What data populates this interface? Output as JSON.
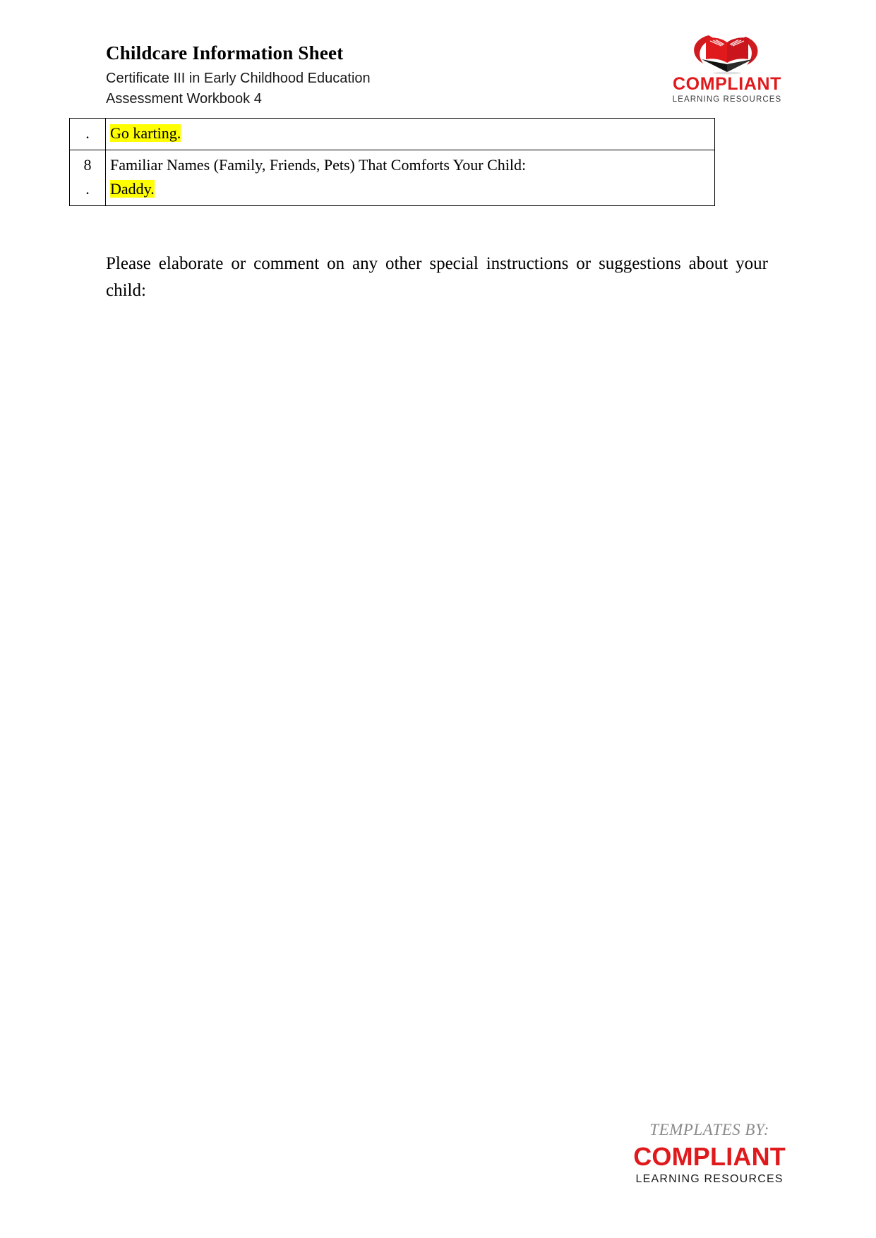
{
  "header": {
    "title": "Childcare Information Sheet",
    "subtitle_1": "Certificate III in Early Childhood Education",
    "subtitle_2": "Assessment Workbook 4",
    "logo": {
      "icon": "open-book-logo-icon",
      "wordmark": "COMPLIANT",
      "tagline": "LEARNING RESOURCES",
      "brand_red": "#e0191c",
      "tagline_color": "#3a3a3a"
    }
  },
  "table": {
    "highlight_color": "#ffff00",
    "border_color": "#000000",
    "rows": [
      {
        "number": ".",
        "number_line_2": "",
        "label": "",
        "answer": "Go karting.",
        "answer_highlighted": true
      },
      {
        "number": "8",
        "number_line_2": ".",
        "label": "Familiar Names (Family, Friends, Pets) That Comforts Your Child:",
        "answer": "Daddy.",
        "answer_highlighted": true
      }
    ]
  },
  "body": {
    "prompt": "Please elaborate or comment on any other special instructions or suggestions about your child:"
  },
  "footer": {
    "templates_by": "TEMPLATES BY:",
    "wordmark": "COMPLIANT",
    "tagline": "LEARNING RESOURCES",
    "brand_red": "#e0191c",
    "templates_color": "#8a8a8a"
  }
}
